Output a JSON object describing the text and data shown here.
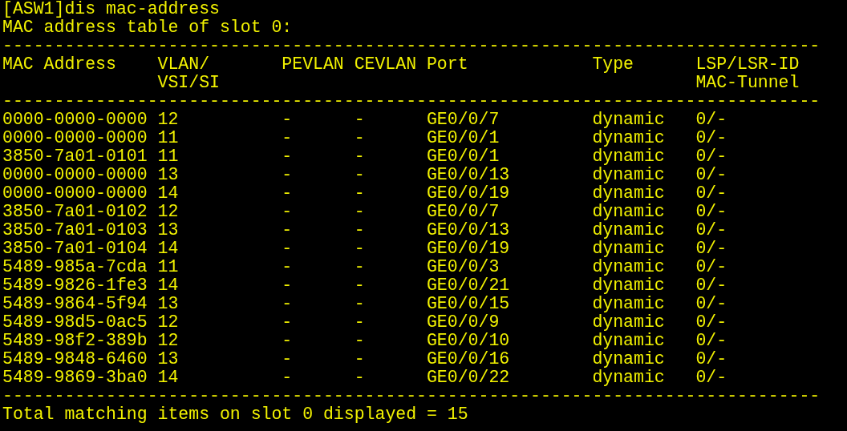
{
  "command": "[ASW1]dis mac-address",
  "title": "MAC address table of slot 0:",
  "separator_top": "-------------------------------------------------------------------------------",
  "columns": [
    {
      "lines": [
        "MAC Address"
      ]
    },
    {
      "lines": [
        "VLAN/",
        "VSI/SI"
      ]
    },
    {
      "lines": [
        "PEVLAN"
      ]
    },
    {
      "lines": [
        "CEVLAN"
      ]
    },
    {
      "lines": [
        "Port"
      ]
    },
    {
      "lines": [
        "Type"
      ]
    },
    {
      "lines": [
        "LSP/LSR-ID",
        "MAC-Tunnel"
      ]
    }
  ],
  "separator_header": "-------------------------------------------------------------------------------",
  "rows": [
    [
      "0000-0000-0000",
      "12",
      "-",
      "-",
      "GE0/0/7",
      "dynamic",
      "0/-"
    ],
    [
      "0000-0000-0000",
      "11",
      "-",
      "-",
      "GE0/0/1",
      "dynamic",
      "0/-"
    ],
    [
      "3850-7a01-0101",
      "11",
      "-",
      "-",
      "GE0/0/1",
      "dynamic",
      "0/-"
    ],
    [
      "0000-0000-0000",
      "13",
      "-",
      "-",
      "GE0/0/13",
      "dynamic",
      "0/-"
    ],
    [
      "0000-0000-0000",
      "14",
      "-",
      "-",
      "GE0/0/19",
      "dynamic",
      "0/-"
    ],
    [
      "3850-7a01-0102",
      "12",
      "-",
      "-",
      "GE0/0/7",
      "dynamic",
      "0/-"
    ],
    [
      "3850-7a01-0103",
      "13",
      "-",
      "-",
      "GE0/0/13",
      "dynamic",
      "0/-"
    ],
    [
      "3850-7a01-0104",
      "14",
      "-",
      "-",
      "GE0/0/19",
      "dynamic",
      "0/-"
    ],
    [
      "5489-985a-7cda",
      "11",
      "-",
      "-",
      "GE0/0/3",
      "dynamic",
      "0/-"
    ],
    [
      "5489-9826-1fe3",
      "14",
      "-",
      "-",
      "GE0/0/21",
      "dynamic",
      "0/-"
    ],
    [
      "5489-9864-5f94",
      "13",
      "-",
      "-",
      "GE0/0/15",
      "dynamic",
      "0/-"
    ],
    [
      "5489-98d5-0ac5",
      "12",
      "-",
      "-",
      "GE0/0/9",
      "dynamic",
      "0/-"
    ],
    [
      "5489-98f2-389b",
      "12",
      "-",
      "-",
      "GE0/0/10",
      "dynamic",
      "0/-"
    ],
    [
      "5489-9848-6460",
      "13",
      "-",
      "-",
      "GE0/0/16",
      "dynamic",
      "0/-"
    ],
    [
      "5489-9869-3ba0",
      "14",
      "-",
      "-",
      "GE0/0/22",
      "dynamic",
      "0/-"
    ]
  ],
  "separator_bottom": "-------------------------------------------------------------------------------",
  "summary": "Total matching items on slot 0 displayed = 15"
}
